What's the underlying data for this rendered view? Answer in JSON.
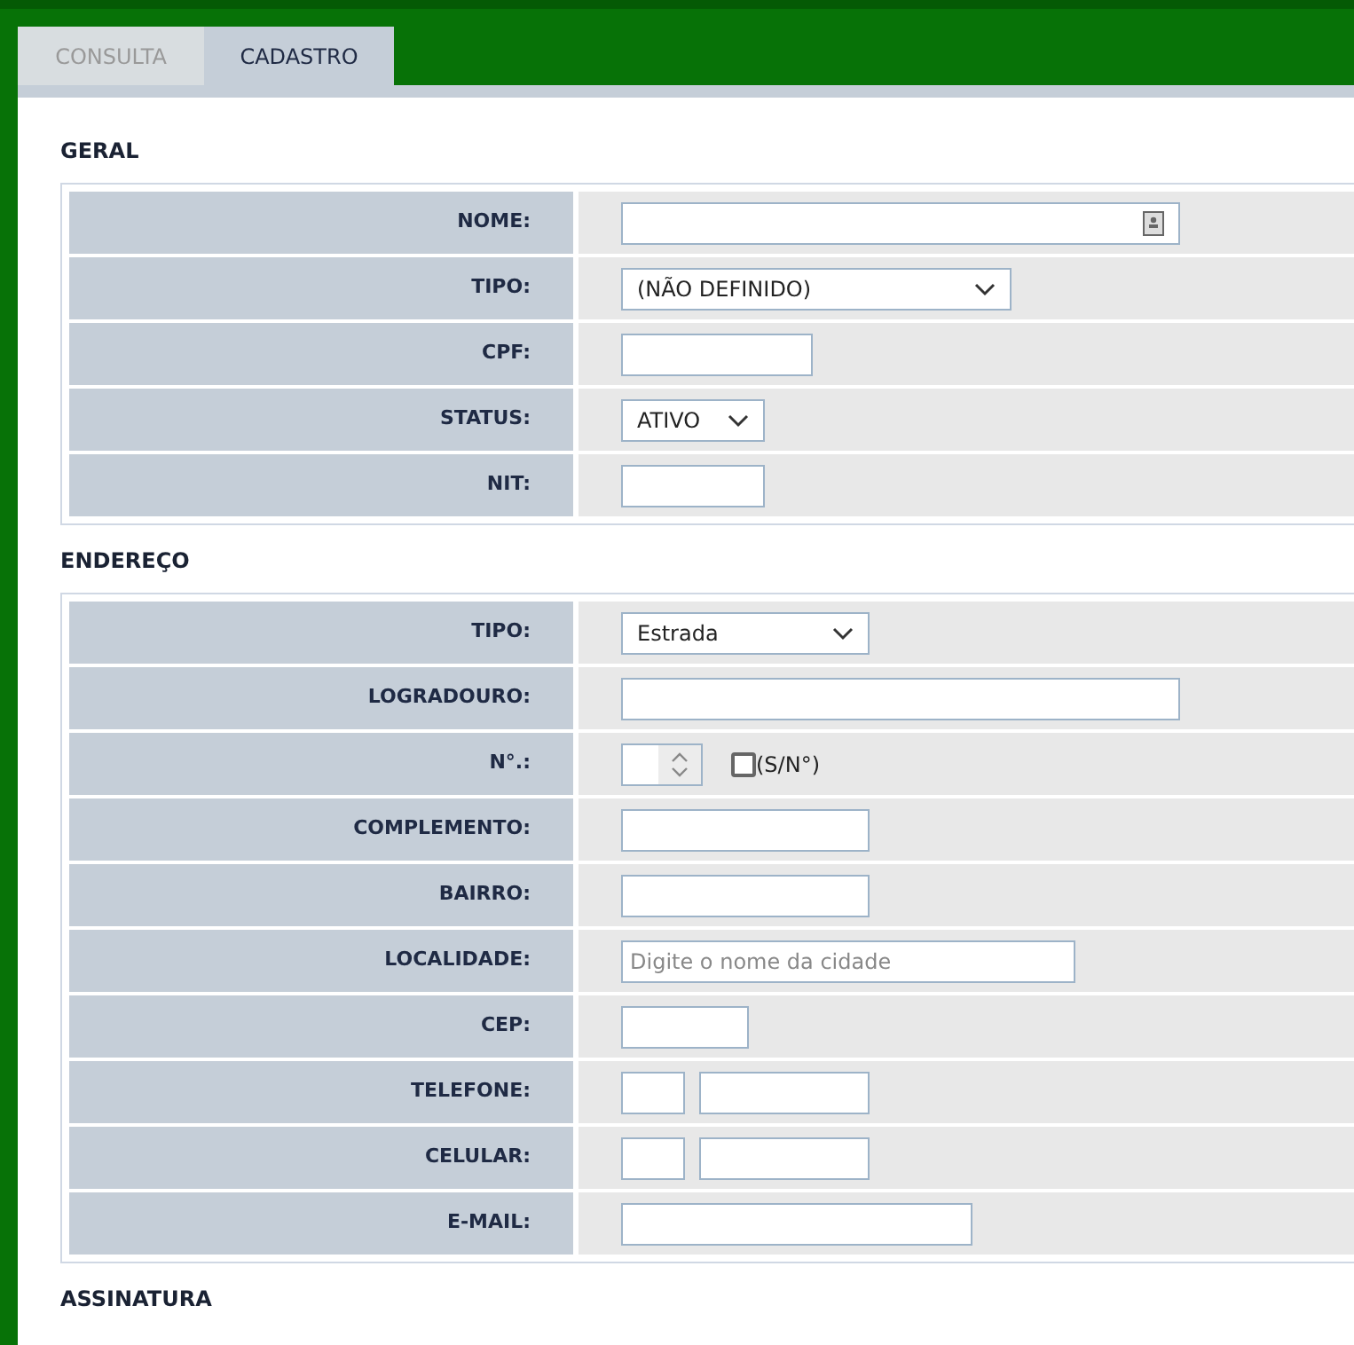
{
  "tabs": [
    {
      "label": "CONSULTA",
      "selected": false
    },
    {
      "label": "CADASTRO",
      "selected": true
    }
  ],
  "sections": [
    {
      "title": "GERAL",
      "rows": [
        {
          "label": "NOME:",
          "kind": "text-icon"
        },
        {
          "label": "TIPO:",
          "kind": "select",
          "value": "(NÃO DEFINIDO)"
        },
        {
          "label": "CPF:",
          "kind": "text"
        },
        {
          "label": "STATUS:",
          "kind": "select",
          "value": "ATIVO"
        },
        {
          "label": "NIT:",
          "kind": "text"
        }
      ]
    },
    {
      "title": "ENDEREÇO",
      "rows": [
        {
          "label": "TIPO:",
          "kind": "select",
          "value": "Estrada"
        },
        {
          "label": "LOGRADOURO:",
          "kind": "text"
        },
        {
          "label": "N°.:",
          "kind": "number",
          "checkbox": {
            "label": "(S/N°)",
            "checked": false
          }
        },
        {
          "label": "COMPLEMENTO:",
          "kind": "text"
        },
        {
          "label": "BAIRRO:",
          "kind": "text"
        },
        {
          "label": "LOCALIDADE:",
          "kind": "text",
          "placeholder": "Digite o nome da cidade"
        },
        {
          "label": "CEP:",
          "kind": "text"
        },
        {
          "label": "TELEFONE:",
          "kind": "phone"
        },
        {
          "label": "CELULAR:",
          "kind": "phone"
        },
        {
          "label": "E-MAIL:",
          "kind": "text"
        }
      ]
    },
    {
      "title": "ASSINATURA"
    }
  ]
}
